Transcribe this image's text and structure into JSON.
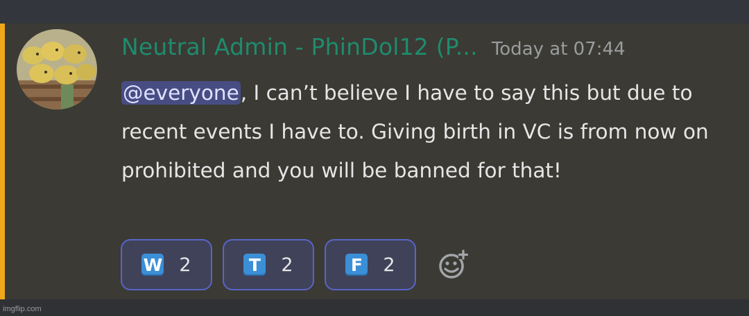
{
  "message": {
    "username": "Neutral Admin - PhinDol12 (P...",
    "timestamp": "Today at 07:44",
    "mention": "@everyone",
    "text_after_mention": ", I can’t believe I have to say this but due to recent events I have to. Giving birth in VC is from now on prohibited and you will be banned for that!",
    "avatar_icon": "avatar-image",
    "colors": {
      "highlight_bar": "#f0a81a",
      "username": "#1f8b6e",
      "mention_bg": "#474d83"
    }
  },
  "reactions": [
    {
      "emoji": "W",
      "count": "2"
    },
    {
      "emoji": "T",
      "count": "2"
    },
    {
      "emoji": "F",
      "count": "2"
    }
  ],
  "add_reaction_icon": "add-reaction-icon",
  "watermark": "imgflip.com"
}
